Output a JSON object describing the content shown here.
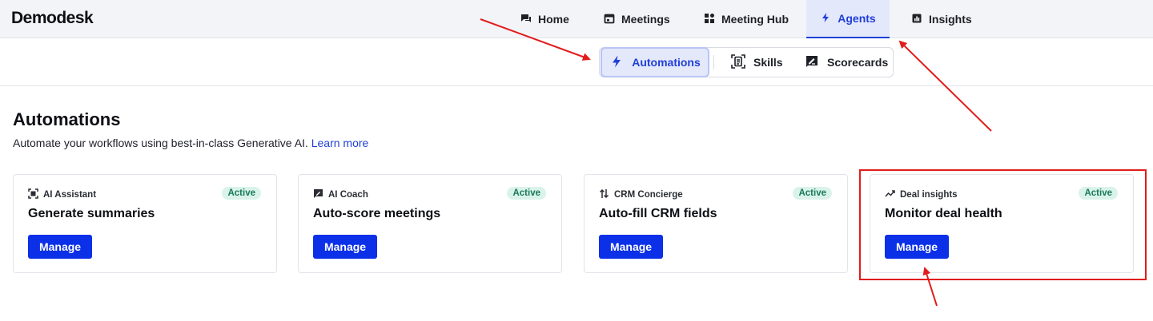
{
  "app": {
    "logo": "Demodesk"
  },
  "nav": {
    "items": [
      {
        "label": "Home",
        "icon": "chat-icon"
      },
      {
        "label": "Meetings",
        "icon": "calendar-icon"
      },
      {
        "label": "Meeting Hub",
        "icon": "grid-icon"
      },
      {
        "label": "Agents",
        "icon": "lightning-icon",
        "active": true
      },
      {
        "label": "Insights",
        "icon": "bar-chart-icon"
      }
    ]
  },
  "subtabs": {
    "items": [
      {
        "label": "Automations",
        "icon": "lightning-icon",
        "active": true
      },
      {
        "label": "Skills",
        "icon": "document-scan-icon"
      },
      {
        "label": "Scorecards",
        "icon": "pen-signature-icon"
      }
    ]
  },
  "page": {
    "title": "Automations",
    "subtitle": "Automate your workflows using best-in-class Generative AI.",
    "learn_more": "Learn more"
  },
  "cards": [
    {
      "category": "AI Assistant",
      "icon": "scan-icon",
      "status": "Active",
      "title": "Generate summaries",
      "action": "Manage"
    },
    {
      "category": "AI Coach",
      "icon": "message-pen-icon",
      "status": "Active",
      "title": "Auto-score meetings",
      "action": "Manage"
    },
    {
      "category": "CRM Concierge",
      "icon": "sync-arrows-icon",
      "status": "Active",
      "title": "Auto-fill CRM fields",
      "action": "Manage"
    },
    {
      "category": "Deal insights",
      "icon": "trend-icon",
      "status": "Active",
      "title": "Monitor deal health",
      "action": "Manage"
    }
  ],
  "colors": {
    "accent": "#1f3fd8",
    "button": "#0b30e8",
    "badge_bg": "#daf3ea",
    "badge_text": "#177a56",
    "annotation": "#e21c1c"
  }
}
